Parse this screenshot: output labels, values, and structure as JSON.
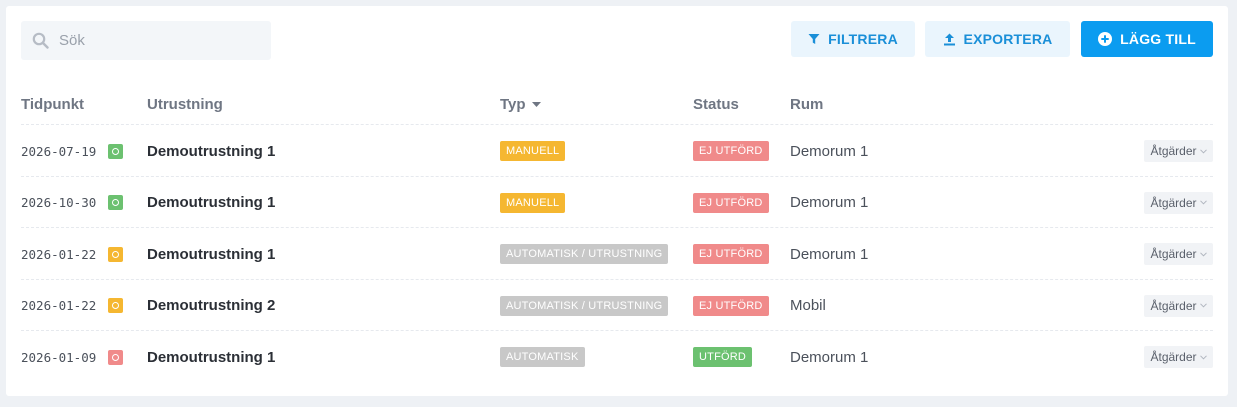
{
  "search": {
    "placeholder": "Sök",
    "value": ""
  },
  "toolbar": {
    "filter_label": "FILTRERA",
    "export_label": "EXPORTERA",
    "add_label": "LÄGG TILL"
  },
  "table": {
    "columns": {
      "time": "Tidpunkt",
      "equipment": "Utrustning",
      "type": "Typ",
      "status": "Status",
      "room": "Rum"
    },
    "action_label": "Åtgärder",
    "rows": [
      {
        "date": "2026-07-19",
        "indicator_color": "#6cc170",
        "equipment": "Demoutrustning 1",
        "type": "MANUELL",
        "type_color": "#f5b731",
        "status": "EJ UTFÖRD",
        "status_color": "#f08a8a",
        "room": "Demorum 1"
      },
      {
        "date": "2026-10-30",
        "indicator_color": "#6cc170",
        "equipment": "Demoutrustning 1",
        "type": "MANUELL",
        "type_color": "#f5b731",
        "status": "EJ UTFÖRD",
        "status_color": "#f08a8a",
        "room": "Demorum 1"
      },
      {
        "date": "2026-01-22",
        "indicator_color": "#f5b731",
        "equipment": "Demoutrustning 1",
        "type": "AUTOMATISK / UTRUSTNING",
        "type_color": "#c8c8c8",
        "status": "EJ UTFÖRD",
        "status_color": "#f08a8a",
        "room": "Demorum 1"
      },
      {
        "date": "2026-01-22",
        "indicator_color": "#f5b731",
        "equipment": "Demoutrustning 2",
        "type": "AUTOMATISK / UTRUSTNING",
        "type_color": "#c8c8c8",
        "status": "EJ UTFÖRD",
        "status_color": "#f08a8a",
        "room": "Mobil"
      },
      {
        "date": "2026-01-09",
        "indicator_color": "#f08a8a",
        "equipment": "Demoutrustning 1",
        "type": "AUTOMATISK",
        "type_color": "#c8c8c8",
        "status": "UTFÖRD",
        "status_color": "#6cc170",
        "room": "Demorum 1"
      }
    ]
  }
}
